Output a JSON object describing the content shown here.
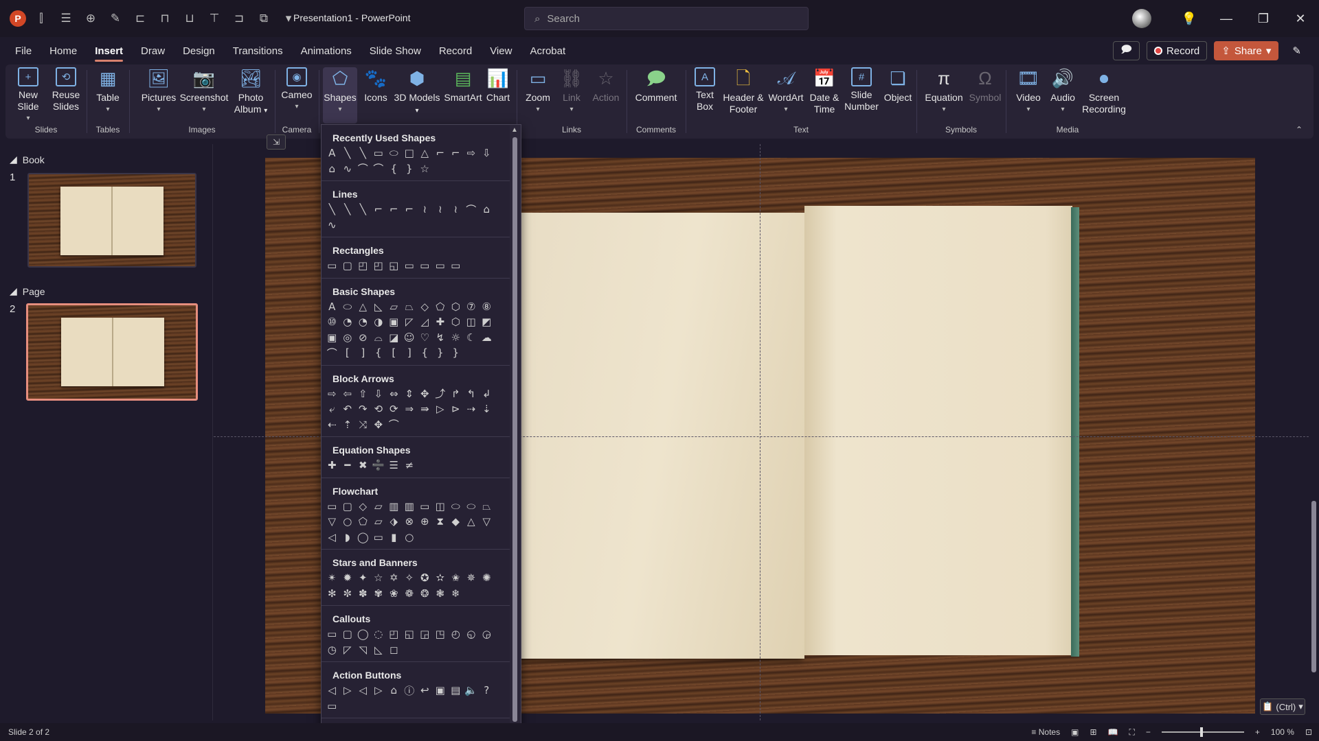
{
  "app": {
    "title": "Presentation1",
    "separator": "-",
    "name": "PowerPoint"
  },
  "search": {
    "placeholder": "Search"
  },
  "tabs": [
    "File",
    "Home",
    "Insert",
    "Draw",
    "Design",
    "Transitions",
    "Animations",
    "Slide Show",
    "Record",
    "View",
    "Acrobat"
  ],
  "active_tab": "Insert",
  "topright": {
    "record": "Record",
    "share": "Share"
  },
  "ribbon": {
    "groups": {
      "slides": "Slides",
      "tables": "Tables",
      "images": "Images",
      "camera": "Camera",
      "links": "Links",
      "comments": "Comments",
      "text": "Text",
      "symbols": "Symbols",
      "media": "Media"
    },
    "buttons": {
      "new_slide": "New Slide",
      "reuse_slides": "Reuse Slides",
      "table": "Table",
      "pictures": "Pictures",
      "screenshot": "Screenshot",
      "photo_album": "Photo Album",
      "cameo": "Cameo",
      "shapes": "Shapes",
      "icons": "Icons",
      "models_3d": "3D Models",
      "smartart": "SmartArt",
      "chart": "Chart",
      "zoom": "Zoom",
      "link": "Link",
      "action": "Action",
      "comment": "Comment",
      "text_box": "Text Box",
      "header_footer": "Header & Footer",
      "wordart": "WordArt",
      "date_time": "Date & Time",
      "slide_number": "Slide Number",
      "object": "Object",
      "equation": "Equation",
      "symbol": "Symbol",
      "video": "Video",
      "audio": "Audio",
      "screen_recording": "Screen Recording"
    }
  },
  "slides_panel": {
    "sections": [
      {
        "name": "Book",
        "slide": "1"
      },
      {
        "name": "Page",
        "slide": "2"
      }
    ]
  },
  "shapes_menu": {
    "categories": [
      {
        "title": "Recently Used Shapes",
        "count": 18
      },
      {
        "title": "Lines",
        "count": 12
      },
      {
        "title": "Rectangles",
        "count": 9
      },
      {
        "title": "Basic Shapes",
        "count": 42
      },
      {
        "title": "Block Arrows",
        "count": 27
      },
      {
        "title": "Equation Shapes",
        "count": 6
      },
      {
        "title": "Flowchart",
        "count": 28
      },
      {
        "title": "Stars and Banners",
        "count": 20
      },
      {
        "title": "Callouts",
        "count": 16
      },
      {
        "title": "Action Buttons",
        "count": 12
      }
    ]
  },
  "paste_tag": "(Ctrl)",
  "status": {
    "slide": "Slide 2 of 2",
    "notes": "Notes",
    "zoom": "100 %"
  }
}
